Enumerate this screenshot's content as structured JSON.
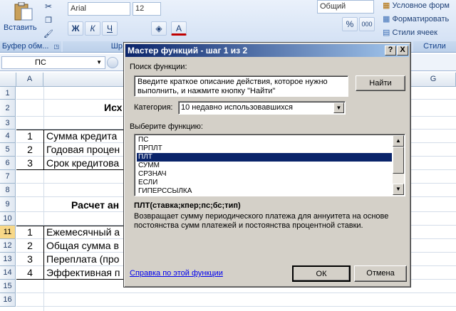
{
  "ribbon": {
    "paste_label": "Вставить",
    "clipboard_label": "Буфер обм...",
    "font_group_label": "Шр",
    "font_name": "Arial",
    "font_size": "12",
    "bold": "Ж",
    "italic": "К",
    "underline": "Ч",
    "font_color_glyph": "А",
    "number_format": "Общий",
    "percent": "%",
    "thousands": "000",
    "conditional_format": "Условное форм",
    "format_table": "Форматировать",
    "cell_styles": "Стили ячеек",
    "styles_group_label": "Стили"
  },
  "formula_bar": {
    "name_box": "ПС"
  },
  "grid": {
    "columns": [
      "A",
      "G"
    ],
    "rows": [
      "1",
      "2",
      "3",
      "4",
      "5",
      "6",
      "7",
      "8",
      "9",
      "10",
      "11",
      "12",
      "13",
      "14",
      "15",
      "16"
    ],
    "selected_row": "11",
    "cells": {
      "r2_title": "Исх",
      "r4_num": "1",
      "r4_text": "Сумма кредита",
      "r5_num": "2",
      "r5_text": "Годовая процен",
      "r6_num": "3",
      "r6_text": "Срок кредитова",
      "r9_title": "Расчет ан",
      "r11_num": "1",
      "r11_text": "Ежемесячный а",
      "r12_num": "2",
      "r12_text": "Общая сумма в",
      "r13_num": "3",
      "r13_text": "Переплата (про",
      "r14_num": "4",
      "r14_text": "Эффективная п"
    }
  },
  "dialog": {
    "title": "Мастер функций - шаг 1 из 2",
    "help_btn": "?",
    "close_btn": "X",
    "search_label": "Поиск функции:",
    "search_value": "Введите краткое описание действия, которое нужно выполнить, и нажмите кнопку \"Найти\"",
    "find_button": "Найти",
    "category_label": "Категория:",
    "category_value": "10 недавно использовавшихся",
    "choose_label": "Выберите функцию:",
    "functions": [
      "ПС",
      "ПРПЛТ",
      "ПЛТ",
      "СУММ",
      "СРЗНАЧ",
      "ЕСЛИ",
      "ГИПЕРССЫЛКА"
    ],
    "selected_function": "ПЛТ",
    "syntax": "ПЛТ(ставка;кпер;пс;бс;тип)",
    "description": "Возвращает сумму периодического платежа для аннуитета на основе постоянства сумм платежей и постоянства процентной ставки.",
    "help_link": "Справка по этой функции",
    "ok_button": "ОК",
    "cancel_button": "Отмена"
  },
  "colors": {
    "title_start": "#0a246a",
    "title_end": "#a6caf0",
    "selection": "#0a246a",
    "link": "#0000ee",
    "row_selected": "#f8d888"
  }
}
